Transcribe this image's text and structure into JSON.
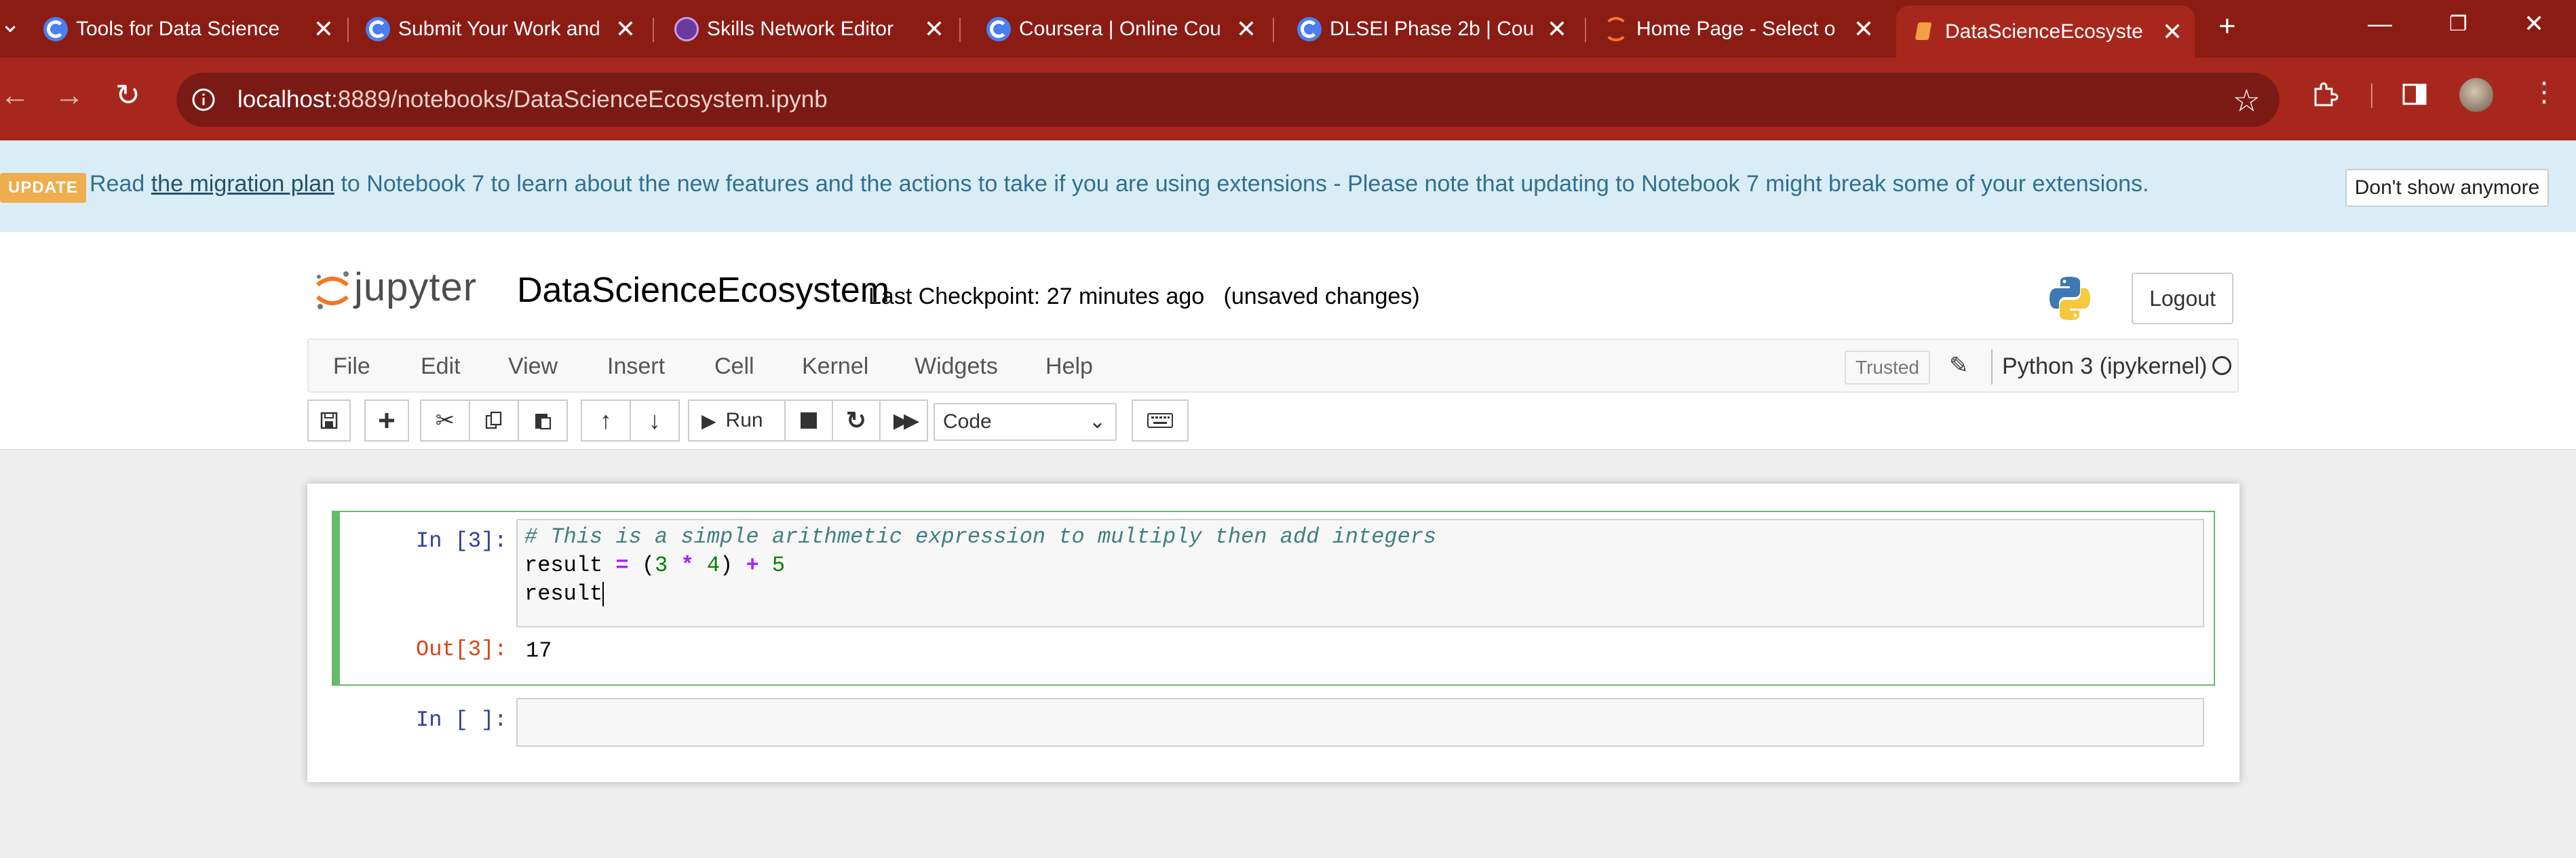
{
  "browser": {
    "tabs": [
      {
        "title": "Tools for Data Science",
        "icon": "coursera-icon"
      },
      {
        "title": "Submit Your Work and",
        "icon": "coursera-icon"
      },
      {
        "title": "Skills Network Editor",
        "icon": "skills-network-icon"
      },
      {
        "title": "Coursera | Online Cou",
        "icon": "coursera-icon"
      },
      {
        "title": "DLSEI Phase 2b | Cou",
        "icon": "coursera-icon"
      },
      {
        "title": "Home Page - Select o",
        "icon": "jupyter-icon"
      },
      {
        "title": "DataScienceEcosyste",
        "icon": "notebook-icon",
        "active": true
      }
    ],
    "new_tab": "+",
    "url_host": "localhost",
    "url_rest": ":8889/notebooks/DataScienceEcosystem.ipynb"
  },
  "banner": {
    "badge": "UPDATE",
    "pre": "Read",
    "link": "the migration plan",
    "post": "to Notebook 7 to learn about the new features and the actions to take if you are using extensions - Please note that updating to Notebook 7 might break some of your extensions.",
    "dismiss": "Don't show anymore"
  },
  "header": {
    "logo_text": "jupyter",
    "notebook_name": "DataScienceEcosystem",
    "checkpoint": "Last Checkpoint: 27 minutes ago",
    "unsaved": "(unsaved changes)",
    "logout": "Logout"
  },
  "menu": {
    "items": [
      "File",
      "Edit",
      "View",
      "Insert",
      "Cell",
      "Kernel",
      "Widgets",
      "Help"
    ],
    "trusted": "Trusted",
    "kernel": "Python 3 (ipykernel)"
  },
  "toolbar": {
    "run": "Run",
    "cell_type": "Code"
  },
  "cells": [
    {
      "prompt": "In [3]:",
      "code_comment": "# This is a simple arithmetic expression to multiply then add integers",
      "line2": {
        "a": "result ",
        "eq": "=",
        "b": " (",
        "n1": "3",
        "sp1": " ",
        "mul": "*",
        "sp2": " ",
        "n2": "4",
        "c": ") ",
        "plus": "+",
        "sp3": " ",
        "n3": "5"
      },
      "line3": "result",
      "out_prompt": "Out[3]:",
      "output": "17"
    },
    {
      "prompt": "In [ ]:"
    }
  ],
  "colors": {
    "tabstrip": "#8b1c14",
    "active_tab": "#a8271d",
    "banner_bg": "#d9edf7",
    "selected_cell": "#66bb6a"
  }
}
